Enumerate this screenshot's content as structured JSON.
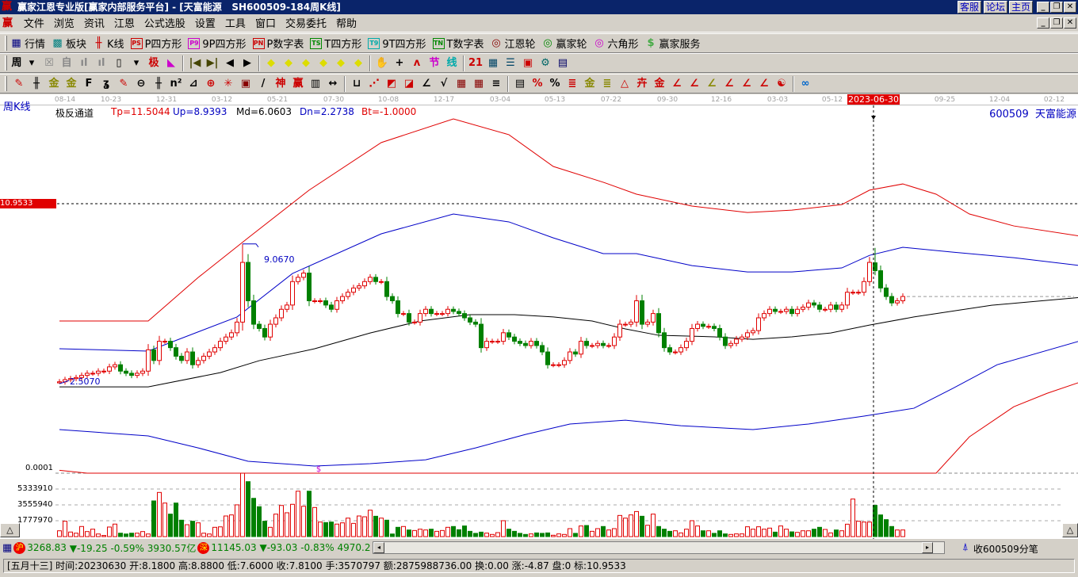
{
  "window": {
    "title": "赢家江恩专业版[赢家内部服务平台] - [天富能源   SH600509-184周K线]",
    "links": [
      "客服",
      "论坛",
      "主页"
    ],
    "controls": [
      "_",
      "❐",
      "✕"
    ]
  },
  "menu": [
    "文件",
    "浏览",
    "资讯",
    "江恩",
    "公式选股",
    "设置",
    "工具",
    "窗口",
    "交易委托",
    "帮助"
  ],
  "toolbar1": [
    {
      "icon": "▦",
      "label": "行情",
      "name": "quotes",
      "color": "#000080"
    },
    {
      "icon": "▩",
      "label": "板块",
      "name": "sectors",
      "color": "#008080"
    },
    {
      "icon": "╫",
      "label": "K线",
      "name": "kline",
      "color": "#c00"
    },
    {
      "icon": "PS",
      "label": "P四方形",
      "name": "p-square",
      "color": "#c00"
    },
    {
      "icon": "P9",
      "label": "9P四方形",
      "name": "9p-square",
      "color": "#c0c"
    },
    {
      "icon": "PN",
      "label": "P数字表",
      "name": "p-number-table",
      "color": "#c00"
    },
    {
      "icon": "TS",
      "label": "T四方形",
      "name": "t-square",
      "color": "#080"
    },
    {
      "icon": "T9",
      "label": "9T四方形",
      "name": "9t-square",
      "color": "#0aa"
    },
    {
      "icon": "TN",
      "label": "T数字表",
      "name": "t-number-table",
      "color": "#080"
    },
    {
      "icon": "◎",
      "label": "江恩轮",
      "name": "gann-wheel",
      "color": "#800"
    },
    {
      "icon": "◎",
      "label": "赢家轮",
      "name": "winner-wheel",
      "color": "#080"
    },
    {
      "icon": "◎",
      "label": "六角形",
      "name": "hexagon",
      "color": "#c0c"
    },
    {
      "icon": "$",
      "label": "赢家服务",
      "name": "winner-service",
      "color": "#4a4"
    }
  ],
  "toolbar2": {
    "period": "周",
    "icons": [
      {
        "g": "▾",
        "c": "#000",
        "n": "period-dropdown"
      },
      {
        "g": "☒",
        "c": "#888",
        "n": "lock"
      },
      {
        "g": "自",
        "c": "#888",
        "n": "auto"
      },
      {
        "g": "ıl",
        "c": "#888",
        "n": "bars-s"
      },
      {
        "g": "ıl",
        "c": "#888",
        "n": "bars-9"
      },
      {
        "g": "▯",
        "c": "#000",
        "n": "candle-type"
      },
      {
        "g": "▾",
        "c": "#000",
        "n": "candle-dropdown"
      },
      {
        "g": "极",
        "c": "#c00",
        "n": "extreme"
      },
      {
        "g": "◣",
        "c": "#c0c",
        "n": "flag"
      },
      {
        "g": "|◀",
        "c": "#440",
        "n": "first"
      },
      {
        "g": "▶|",
        "c": "#440",
        "n": "last"
      },
      {
        "g": "◀",
        "c": "#000",
        "n": "prev"
      },
      {
        "g": "▶",
        "c": "#000",
        "n": "next"
      },
      {
        "g": "◆",
        "c": "#dd0",
        "n": "left"
      },
      {
        "g": "◆",
        "c": "#dd0",
        "n": "right"
      },
      {
        "g": "◆",
        "c": "#dd0",
        "n": "expand"
      },
      {
        "g": "◆",
        "c": "#dd0",
        "n": "shrink"
      },
      {
        "g": "◆",
        "c": "#dd0",
        "n": "zoom-in"
      },
      {
        "g": "◆",
        "c": "#dd0",
        "n": "zoom-out"
      },
      {
        "g": "✋",
        "c": "#000",
        "n": "hand"
      },
      {
        "g": "+",
        "c": "#000",
        "n": "crosshair"
      },
      {
        "g": "ʌ",
        "c": "#c00",
        "n": "wave"
      },
      {
        "g": "节",
        "c": "#c0c",
        "n": "solar-term"
      },
      {
        "g": "线",
        "c": "#0aa",
        "n": "line-style"
      },
      {
        "g": "21",
        "c": "#c00",
        "n": "calendar"
      },
      {
        "g": "▦",
        "c": "#046",
        "n": "calculator"
      },
      {
        "g": "☰",
        "c": "#046",
        "n": "notes"
      },
      {
        "g": "▣",
        "c": "#c00",
        "n": "save"
      },
      {
        "g": "⚙",
        "c": "#066",
        "n": "settings"
      },
      {
        "g": "▤",
        "c": "#006",
        "n": "print"
      }
    ]
  },
  "toolbar3": [
    {
      "g": "✎",
      "c": "#c00",
      "n": "pen"
    },
    {
      "g": "╫",
      "c": "#000",
      "n": "parallel"
    },
    {
      "g": "金",
      "c": "#880",
      "n": "gold-1"
    },
    {
      "g": "金",
      "c": "#880",
      "n": "gold-2"
    },
    {
      "g": "F",
      "c": "#000",
      "n": "fib"
    },
    {
      "g": "ʓ",
      "c": "#000",
      "n": "spiral"
    },
    {
      "g": "✎",
      "c": "#c00",
      "n": "pen-2"
    },
    {
      "g": "⊖",
      "c": "#000",
      "n": "circle"
    },
    {
      "g": "╫",
      "c": "#000",
      "n": "lines"
    },
    {
      "g": "n²",
      "c": "#000",
      "n": "square"
    },
    {
      "g": "⊿",
      "c": "#000",
      "n": "triangle"
    },
    {
      "g": "⊕",
      "c": "#c00",
      "n": "target"
    },
    {
      "g": "✳",
      "c": "#c00",
      "n": "star"
    },
    {
      "g": "▣",
      "c": "#800",
      "n": "box"
    },
    {
      "g": "/",
      "c": "#000",
      "n": "slash"
    },
    {
      "g": "神",
      "c": "#c00",
      "n": "god"
    },
    {
      "g": "赢",
      "c": "#c00",
      "n": "win"
    },
    {
      "g": "▥",
      "c": "#000",
      "n": "grid"
    },
    {
      "g": "↔",
      "c": "#000",
      "n": "measure"
    },
    {
      "g": "⊔",
      "c": "#000",
      "n": "frame"
    },
    {
      "g": "⋰",
      "c": "#c00",
      "n": "fan"
    },
    {
      "g": "◩",
      "c": "#c00",
      "n": "fan-box"
    },
    {
      "g": "◪",
      "c": "#c00",
      "n": "fan-box-2"
    },
    {
      "g": "∠",
      "c": "#000",
      "n": "angle"
    },
    {
      "g": "√",
      "c": "#000",
      "n": "check"
    },
    {
      "g": "▦",
      "c": "#800",
      "n": "grid-2"
    },
    {
      "g": "▦",
      "c": "#800",
      "n": "grid-3"
    },
    {
      "g": "≡",
      "c": "#000",
      "n": "channel"
    },
    {
      "g": "▤",
      "c": "#000",
      "n": "table"
    },
    {
      "g": "%",
      "c": "#c00",
      "n": "percent-1"
    },
    {
      "g": "%",
      "c": "#000",
      "n": "percent-2"
    },
    {
      "g": "≣",
      "c": "#c00",
      "n": "pct-lines"
    },
    {
      "g": "金",
      "c": "#880",
      "n": "gold-3"
    },
    {
      "g": "≣",
      "c": "#880",
      "n": "gold-lines"
    },
    {
      "g": "△",
      "c": "#c00",
      "n": "triangle-2"
    },
    {
      "g": "卉",
      "c": "#c00",
      "n": "pattern"
    },
    {
      "g": "金",
      "c": "#c00",
      "n": "gold-4"
    },
    {
      "g": "∠",
      "c": "#c00",
      "n": "angle-j"
    },
    {
      "g": "∠",
      "c": "#c00",
      "n": "angle-f"
    },
    {
      "g": "∠",
      "c": "#880",
      "n": "angle-g"
    },
    {
      "g": "∠",
      "c": "#c00",
      "n": "angle-s"
    },
    {
      "g": "∠",
      "c": "#c00",
      "n": "angle-w"
    },
    {
      "g": "∠",
      "c": "#c00",
      "n": "angle-4"
    },
    {
      "g": "☯",
      "c": "#c00",
      "n": "yin-yang"
    },
    {
      "g": "∞",
      "c": "#06c",
      "n": "infinity"
    }
  ],
  "chart_header": {
    "period_label": "周K线",
    "indicator": "极反通道",
    "tp": "Tp=11.5044",
    "up": "Up=8.9393",
    "md": "Md=6.0603",
    "dn": "Dn=2.2738",
    "bt": "Bt=-1.0000",
    "stock": "600509  天富能源"
  },
  "chart_data": {
    "type": "candlestick",
    "title": "天富能源 SH600509 周K线",
    "date_ticks": [
      "08-14",
      "10-23",
      "12-31",
      "03-12",
      "05-21",
      "07-30",
      "10-08",
      "12-17",
      "03-04",
      "05-13",
      "07-22",
      "09-30",
      "12-16",
      "03-03",
      "05-12",
      "2023-06-30",
      "09-25",
      "12-04",
      "02-12"
    ],
    "selected_date": "2023-06-30",
    "selected_index": 147,
    "price_marker": "10.9533",
    "bottom_label": "0.0001",
    "annotations": {
      "high": "9.0670",
      "high_index": 33,
      "low": "2.5070",
      "low_index": 0
    },
    "ylim": [
      -1.69,
      15.5
    ],
    "close": [
      2.6,
      2.7,
      2.75,
      2.8,
      2.9,
      3.0,
      3.0,
      3.1,
      3.1,
      3.3,
      3.4,
      3.1,
      3.0,
      2.9,
      3.0,
      3.1,
      4.1,
      3.6,
      4.5,
      4.5,
      4.2,
      3.8,
      3.6,
      4.0,
      3.4,
      3.6,
      3.8,
      4.0,
      4.2,
      4.5,
      4.7,
      4.9,
      5.4,
      8.2,
      6.4,
      5.3,
      5.1,
      4.7,
      5.3,
      5.6,
      6.0,
      6.2,
      7.3,
      7.5,
      7.7,
      6.4,
      6.4,
      6.4,
      6.2,
      6.0,
      6.4,
      6.6,
      6.8,
      7.0,
      7.1,
      7.3,
      7.5,
      7.3,
      7.3,
      6.6,
      6.4,
      5.8,
      5.8,
      5.4,
      5.4,
      5.8,
      6.0,
      5.8,
      5.8,
      5.8,
      6.0,
      5.9,
      5.8,
      5.6,
      5.4,
      5.3,
      4.2,
      4.5,
      4.5,
      4.5,
      4.9,
      4.7,
      4.5,
      4.4,
      4.3,
      4.5,
      4.3,
      4.0,
      3.4,
      3.4,
      3.4,
      3.6,
      4.0,
      3.9,
      4.5,
      4.3,
      4.3,
      4.4,
      4.3,
      4.3,
      4.7,
      5.3,
      5.3,
      5.4,
      6.4,
      5.3,
      5.4,
      5.8,
      4.9,
      4.2,
      4.0,
      4.0,
      4.2,
      4.5,
      5.1,
      5.3,
      5.2,
      5.2,
      5.1,
      4.7,
      4.3,
      4.4,
      4.6,
      4.7,
      4.9,
      5.0,
      5.6,
      5.8,
      6.0,
      5.9,
      5.9,
      6.0,
      5.8,
      6.0,
      6.1,
      6.3,
      6.2,
      6.0,
      6.0,
      6.2,
      6.0,
      6.2,
      6.8,
      6.8,
      6.8,
      7.3,
      8.2,
      7.81,
      7.0,
      6.6,
      6.3,
      6.4,
      6.6
    ],
    "volume_millions": [
      0.65,
      1.72,
      0.51,
      0.38,
      1.13,
      0.56,
      0.83,
      0.29,
      0.12,
      1.07,
      1.4,
      0.38,
      0.29,
      0.38,
      0.38,
      0.56,
      0.29,
      4.0,
      4.95,
      3.76,
      2.52,
      3.76,
      1.84,
      1.33,
      1.72,
      1.54,
      0.38,
      0.29,
      1.04,
      1.09,
      2.31,
      2.43,
      3.56,
      7.11,
      6.16,
      4.29,
      3.35,
      1.72,
      1.04,
      2.52,
      3.49,
      2.67,
      3.62,
      5.09,
      3.4,
      5.09,
      3.26,
      1.63,
      1.57,
      1.63,
      1.4,
      1.54,
      2.07,
      1.48,
      2.31,
      2.22,
      2.96,
      2.28,
      2.07,
      1.84,
      0.29,
      1.04,
      1.13,
      0.74,
      0.68,
      0.83,
      0.74,
      0.83,
      0.59,
      0.68,
      1.04,
      1.13,
      0.77,
      1.19,
      0.59,
      0.36,
      0.5,
      0.39,
      0.24,
      0.44,
      1.78,
      0.83,
      0.59,
      0.36,
      0.24,
      0.3,
      0.41,
      0.36,
      0.41,
      0.15,
      0.3,
      0.24,
      0.89,
      0.36,
      1.19,
      1.24,
      0.59,
      0.89,
      1.13,
      0.74,
      0.89,
      2.37,
      2.07,
      2.43,
      2.81,
      2.28,
      1.27,
      2.52,
      1.13,
      0.83,
      0.59,
      0.65,
      0.41,
      0.83,
      1.78,
      1.19,
      0.65,
      0.65,
      0.36,
      0.65,
      0.3,
      0.24,
      0.3,
      0.3,
      1.1,
      0.83,
      1.1,
      0.83,
      0.95,
      0.5,
      1.19,
      0.83,
      0.53,
      0.47,
      0.65,
      0.65,
      0.83,
      1.04,
      0.8,
      0.41,
      0.74,
      0.65,
      1.39,
      4.21,
      1.72,
      1.63,
      1.63,
      3.5,
      2.43,
      1.9,
      1.13,
      0.74,
      0.74
    ],
    "volume_ticks": [
      "5333910",
      "3555940",
      "1777970"
    ],
    "bands": [
      {
        "name": "Tp",
        "color": "#e00000",
        "points": [
          [
            0,
            5.45
          ],
          [
            16,
            5.45
          ],
          [
            25,
            7.49
          ],
          [
            34,
            9.35
          ],
          [
            45,
            11.59
          ],
          [
            58,
            13.82
          ],
          [
            71,
            14.93
          ],
          [
            81,
            14.19
          ],
          [
            89,
            12.7
          ],
          [
            98,
            11.96
          ],
          [
            104,
            11.4
          ],
          [
            114,
            10.84
          ],
          [
            124,
            10.54
          ],
          [
            132,
            10.65
          ],
          [
            141,
            10.91
          ],
          [
            146,
            11.59
          ],
          [
            152,
            11.88
          ],
          [
            158,
            11.4
          ],
          [
            164,
            10.47
          ],
          [
            172,
            9.91
          ],
          [
            184,
            9.43
          ]
        ]
      },
      {
        "name": "Up",
        "color": "#0000c8",
        "points": [
          [
            0,
            4.15
          ],
          [
            16,
            4.04
          ],
          [
            32,
            5.64
          ],
          [
            42,
            7.68
          ],
          [
            58,
            9.54
          ],
          [
            71,
            10.47
          ],
          [
            81,
            10.1
          ],
          [
            89,
            9.35
          ],
          [
            98,
            8.61
          ],
          [
            104,
            8.61
          ],
          [
            114,
            8.05
          ],
          [
            124,
            7.75
          ],
          [
            132,
            7.75
          ],
          [
            141,
            7.94
          ],
          [
            146,
            8.53
          ],
          [
            152,
            8.91
          ],
          [
            161,
            8.68
          ],
          [
            172,
            8.42
          ],
          [
            184,
            8.05
          ]
        ]
      },
      {
        "name": "Md",
        "color": "#000000",
        "points": [
          [
            0,
            2.36
          ],
          [
            16,
            2.36
          ],
          [
            29,
            3.03
          ],
          [
            36,
            3.59
          ],
          [
            46,
            4.15
          ],
          [
            56,
            4.89
          ],
          [
            65,
            5.45
          ],
          [
            74,
            5.75
          ],
          [
            82,
            5.75
          ],
          [
            89,
            5.64
          ],
          [
            96,
            5.45
          ],
          [
            102,
            5.08
          ],
          [
            108,
            4.78
          ],
          [
            118,
            4.71
          ],
          [
            125,
            4.59
          ],
          [
            132,
            4.71
          ],
          [
            139,
            4.89
          ],
          [
            146,
            5.26
          ],
          [
            154,
            5.64
          ],
          [
            168,
            6.19
          ],
          [
            184,
            6.56
          ]
        ]
      },
      {
        "name": "Dn",
        "color": "#0000c8",
        "points": [
          [
            0,
            0.36
          ],
          [
            16,
            0.06
          ],
          [
            25,
            -0.5
          ],
          [
            34,
            -1.13
          ],
          [
            46,
            -1.35
          ],
          [
            56,
            -1.24
          ],
          [
            66,
            -1.06
          ],
          [
            75,
            -0.5
          ],
          [
            84,
            0.13
          ],
          [
            92,
            0.62
          ],
          [
            102,
            0.8
          ],
          [
            112,
            0.54
          ],
          [
            125,
            0.36
          ],
          [
            135,
            0.62
          ],
          [
            145,
            0.99
          ],
          [
            154,
            1.36
          ],
          [
            161,
            2.29
          ],
          [
            169,
            3.4
          ],
          [
            184,
            4.52
          ]
        ]
      },
      {
        "name": "Bt",
        "color": "#e00000",
        "points": [
          [
            0,
            -1.55
          ],
          [
            5,
            -1.69
          ],
          [
            158,
            -1.69
          ],
          [
            164,
            0.02
          ],
          [
            172,
            1.43
          ],
          [
            178,
            2.06
          ],
          [
            184,
            2.59
          ]
        ]
      }
    ]
  },
  "status": {
    "sh_badge": "沪",
    "sh_index": "3268.83",
    "sh_change": "▼-19.25 -0.59% 3930.57亿",
    "sz_badge": "深",
    "sz_index": "11145.03",
    "sz_change": "▼-93.03 -0.83% 4970.2",
    "tick_link": "收600509分笔"
  },
  "info_bar": "[五月十三] 时间:20230630 开:8.1800 高:8.8800 低:7.6000 收:7.8100 手:3570797 额:2875988736.00 换:0.00 涨:-4.87 盘:0 标:10.9533",
  "colors": {
    "up": "#e00000",
    "down": "#008000",
    "title_bg": "#0a246a"
  }
}
